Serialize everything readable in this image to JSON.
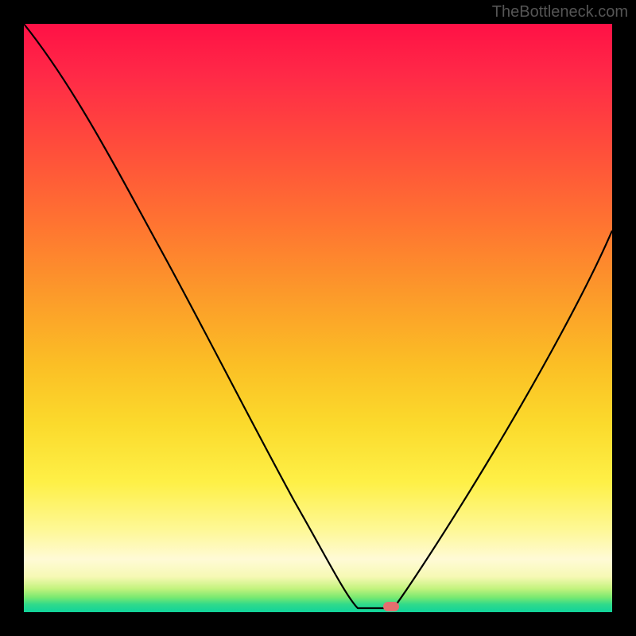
{
  "watermark": "TheBottleneck.com",
  "chart_data": {
    "type": "line",
    "title": "",
    "xlabel": "",
    "ylabel": "",
    "xlim": [
      0,
      100
    ],
    "ylim": [
      0,
      100
    ],
    "x": [
      0,
      10,
      20,
      30,
      40,
      50,
      56,
      58,
      62,
      64,
      70,
      80,
      90,
      100
    ],
    "values": [
      100,
      88,
      75,
      60,
      43,
      24,
      5,
      0,
      0,
      1,
      12,
      33,
      52,
      68
    ],
    "marker": {
      "x": 62,
      "y": 0
    },
    "background_gradient": {
      "top": "#ff1146",
      "mid": "#fbda2c",
      "bottom": "#10d39b"
    }
  }
}
